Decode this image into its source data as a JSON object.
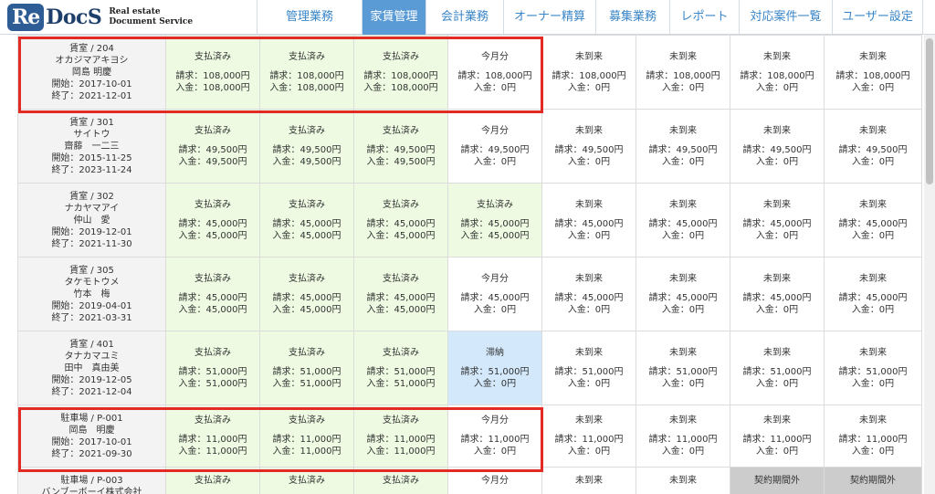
{
  "logo": {
    "re": "Re",
    "docs": "DocS",
    "line1": "Real estate",
    "line2": "Document Service"
  },
  "nav": [
    {
      "label": "管理業務",
      "active": false
    },
    {
      "label": "家賃管理",
      "active": true
    },
    {
      "label": "会計業務",
      "active": false
    },
    {
      "label": "オーナー精算",
      "active": false
    },
    {
      "label": "募集業務",
      "active": false
    },
    {
      "label": "レポート",
      "active": false
    },
    {
      "label": "対応案件一覧",
      "active": false
    },
    {
      "label": "ユーザー設定",
      "active": false
    }
  ],
  "rows": [
    {
      "room": "賃室 / 204",
      "kana": "オカジマアキヨシ",
      "name": "岡島 明慶",
      "start": "開始：2017-10-01",
      "end": "終了：2021-12-01",
      "cells": [
        {
          "status": "支払済み",
          "billed": "請求：108,000円",
          "received": "入金：108,000円",
          "kind": "paid"
        },
        {
          "status": "支払済み",
          "billed": "請求：108,000円",
          "received": "入金：108,000円",
          "kind": "paid"
        },
        {
          "status": "支払済み",
          "billed": "請求：108,000円",
          "received": "入金：108,000円",
          "kind": "paid"
        },
        {
          "status": "今月分",
          "billed": "請求：108,000円",
          "received": "入金：0円",
          "kind": "plain"
        },
        {
          "status": "未到来",
          "billed": "請求：108,000円",
          "received": "入金：0円",
          "kind": "plain"
        },
        {
          "status": "未到来",
          "billed": "請求：108,000円",
          "received": "入金：0円",
          "kind": "plain"
        },
        {
          "status": "未到来",
          "billed": "請求：108,000円",
          "received": "入金：0円",
          "kind": "plain"
        },
        {
          "status": "未到来",
          "billed": "請求：108,000円",
          "received": "入金：0円",
          "kind": "plain"
        }
      ]
    },
    {
      "room": "賃室 / 301",
      "kana": "サイトウ",
      "name": "齋藤　一二三",
      "start": "開始：2015-11-25",
      "end": "終了：2023-11-24",
      "cells": [
        {
          "status": "支払済み",
          "billed": "請求：49,500円",
          "received": "入金：49,500円",
          "kind": "paid"
        },
        {
          "status": "支払済み",
          "billed": "請求：49,500円",
          "received": "入金：49,500円",
          "kind": "paid"
        },
        {
          "status": "支払済み",
          "billed": "請求：49,500円",
          "received": "入金：49,500円",
          "kind": "paid"
        },
        {
          "status": "今月分",
          "billed": "請求：49,500円",
          "received": "入金：0円",
          "kind": "plain"
        },
        {
          "status": "未到来",
          "billed": "請求：49,500円",
          "received": "入金：0円",
          "kind": "plain"
        },
        {
          "status": "未到来",
          "billed": "請求：49,500円",
          "received": "入金：0円",
          "kind": "plain"
        },
        {
          "status": "未到来",
          "billed": "請求：49,500円",
          "received": "入金：0円",
          "kind": "plain"
        },
        {
          "status": "未到来",
          "billed": "請求：49,500円",
          "received": "入金：0円",
          "kind": "plain"
        }
      ]
    },
    {
      "room": "賃室 / 302",
      "kana": "ナカヤマアイ",
      "name": "仲山　愛",
      "start": "開始：2019-12-01",
      "end": "終了：2021-11-30",
      "cells": [
        {
          "status": "支払済み",
          "billed": "請求：45,000円",
          "received": "入金：45,000円",
          "kind": "paid"
        },
        {
          "status": "支払済み",
          "billed": "請求：45,000円",
          "received": "入金：45,000円",
          "kind": "paid"
        },
        {
          "status": "支払済み",
          "billed": "請求：45,000円",
          "received": "入金：45,000円",
          "kind": "paid"
        },
        {
          "status": "支払済み",
          "billed": "請求：45,000円",
          "received": "入金：45,000円",
          "kind": "paid"
        },
        {
          "status": "未到来",
          "billed": "請求：45,000円",
          "received": "入金：0円",
          "kind": "plain"
        },
        {
          "status": "未到来",
          "billed": "請求：45,000円",
          "received": "入金：0円",
          "kind": "plain"
        },
        {
          "status": "未到来",
          "billed": "請求：45,000円",
          "received": "入金：0円",
          "kind": "plain"
        },
        {
          "status": "未到来",
          "billed": "請求：45,000円",
          "received": "入金：0円",
          "kind": "plain"
        }
      ]
    },
    {
      "room": "賃室 / 305",
      "kana": "タケモトウメ",
      "name": "竹本　梅",
      "start": "開始：2019-04-01",
      "end": "終了：2021-03-31",
      "cells": [
        {
          "status": "支払済み",
          "billed": "請求：45,000円",
          "received": "入金：45,000円",
          "kind": "paid"
        },
        {
          "status": "支払済み",
          "billed": "請求：45,000円",
          "received": "入金：45,000円",
          "kind": "paid"
        },
        {
          "status": "支払済み",
          "billed": "請求：45,000円",
          "received": "入金：45,000円",
          "kind": "paid"
        },
        {
          "status": "今月分",
          "billed": "請求：45,000円",
          "received": "入金：0円",
          "kind": "plain"
        },
        {
          "status": "未到来",
          "billed": "請求：45,000円",
          "received": "入金：0円",
          "kind": "plain"
        },
        {
          "status": "未到来",
          "billed": "請求：45,000円",
          "received": "入金：0円",
          "kind": "plain"
        },
        {
          "status": "未到来",
          "billed": "請求：45,000円",
          "received": "入金：0円",
          "kind": "plain"
        },
        {
          "status": "未到来",
          "billed": "請求：45,000円",
          "received": "入金：0円",
          "kind": "plain"
        }
      ]
    },
    {
      "room": "賃室 / 401",
      "kana": "タナカマユミ",
      "name": "田中　真由美",
      "start": "開始：2019-12-05",
      "end": "終了：2021-12-04",
      "cells": [
        {
          "status": "支払済み",
          "billed": "請求：51,000円",
          "received": "入金：51,000円",
          "kind": "paid"
        },
        {
          "status": "支払済み",
          "billed": "請求：51,000円",
          "received": "入金：51,000円",
          "kind": "paid"
        },
        {
          "status": "支払済み",
          "billed": "請求：51,000円",
          "received": "入金：51,000円",
          "kind": "paid"
        },
        {
          "status": "滞納",
          "billed": "請求：51,000円",
          "received": "入金：0円",
          "kind": "arrears"
        },
        {
          "status": "未到来",
          "billed": "請求：51,000円",
          "received": "入金：0円",
          "kind": "plain"
        },
        {
          "status": "未到来",
          "billed": "請求：51,000円",
          "received": "入金：0円",
          "kind": "plain"
        },
        {
          "status": "未到来",
          "billed": "請求：51,000円",
          "received": "入金：0円",
          "kind": "plain"
        },
        {
          "status": "未到来",
          "billed": "請求：51,000円",
          "received": "入金：0円",
          "kind": "plain"
        }
      ]
    },
    {
      "room": "駐車場 / P-001",
      "kana": "岡島　明慶",
      "name": "",
      "start": "開始：2017-10-01",
      "end": "終了：2021-09-30",
      "cells": [
        {
          "status": "支払済み",
          "billed": "請求：11,000円",
          "received": "入金：11,000円",
          "kind": "paid"
        },
        {
          "status": "支払済み",
          "billed": "請求：11,000円",
          "received": "入金：11,000円",
          "kind": "paid"
        },
        {
          "status": "支払済み",
          "billed": "請求：11,000円",
          "received": "入金：11,000円",
          "kind": "paid"
        },
        {
          "status": "今月分",
          "billed": "請求：11,000円",
          "received": "入金：0円",
          "kind": "plain"
        },
        {
          "status": "未到来",
          "billed": "請求：11,000円",
          "received": "入金：0円",
          "kind": "plain"
        },
        {
          "status": "未到来",
          "billed": "請求：11,000円",
          "received": "入金：0円",
          "kind": "plain"
        },
        {
          "status": "未到来",
          "billed": "請求：11,000円",
          "received": "入金：0円",
          "kind": "plain"
        },
        {
          "status": "未到来",
          "billed": "請求：11,000円",
          "received": "入金：0円",
          "kind": "plain"
        }
      ]
    },
    {
      "room": "駐車場 / P-003",
      "kana": "バンブーボーイ株式会社",
      "name": "",
      "start": "",
      "end": "",
      "cells": [
        {
          "status": "支払済み",
          "billed": "",
          "received": "",
          "kind": "paid"
        },
        {
          "status": "支払済み",
          "billed": "",
          "received": "",
          "kind": "paid"
        },
        {
          "status": "支払済み",
          "billed": "",
          "received": "",
          "kind": "paid"
        },
        {
          "status": "今月分",
          "billed": "",
          "received": "",
          "kind": "plain"
        },
        {
          "status": "未到来",
          "billed": "",
          "received": "",
          "kind": "plain"
        },
        {
          "status": "未到来",
          "billed": "",
          "received": "",
          "kind": "plain"
        },
        {
          "status": "契約期間外",
          "billed": "",
          "received": "",
          "kind": "outside"
        },
        {
          "status": "契約期間外",
          "billed": "",
          "received": "",
          "kind": "outside"
        }
      ]
    }
  ],
  "colors": {
    "accent": "#5b9bd5",
    "nav_text": "#3a86c8",
    "paid_bg": "#eefbe2",
    "arrears_bg": "#d3e8fb",
    "outside_bg": "#cccccc",
    "highlight": "#e32b26"
  }
}
